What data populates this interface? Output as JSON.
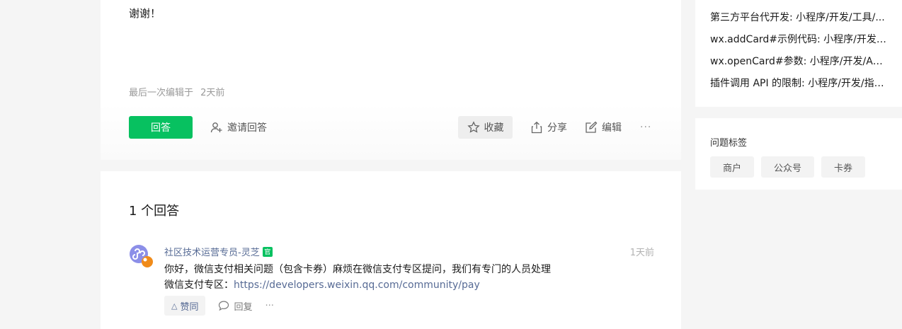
{
  "question": {
    "text": "谢谢！",
    "edit_label": "最后一次编辑于",
    "edit_time": "2天前",
    "actions": {
      "answer": "回答",
      "invite": "邀请回答",
      "collect": "收藏",
      "share": "分享",
      "edit": "编辑",
      "more": "···"
    }
  },
  "answers": {
    "title": "1 个回答",
    "items": [
      {
        "author": "社区技术运营专员-灵芝",
        "badge": "官",
        "time": "1天前",
        "line1": "你好，微信支付相关问题（包含卡券）麻烦在微信支付专区提问，我们有专门的人员处理",
        "line2_prefix": "微信支付专区：",
        "link": "https://developers.weixin.qq.com/community/pay",
        "like": "赞同",
        "reply": "回复",
        "more": "···"
      }
    ]
  },
  "related": {
    "items": [
      "第三方平台代开发: 小程序/开发/工具/...",
      "wx.addCard#示例代码: 小程序/开发/A...",
      "wx.openCard#参数: 小程序/开发/API/...",
      "插件调用 API 的限制: 小程序/开发/指南..."
    ]
  },
  "tags": {
    "title": "问题标签",
    "items": [
      "商户",
      "公众号",
      "卡券"
    ]
  },
  "colors": {
    "accent": "#07c160",
    "link": "#576b95",
    "background": "#f5f5f5"
  }
}
